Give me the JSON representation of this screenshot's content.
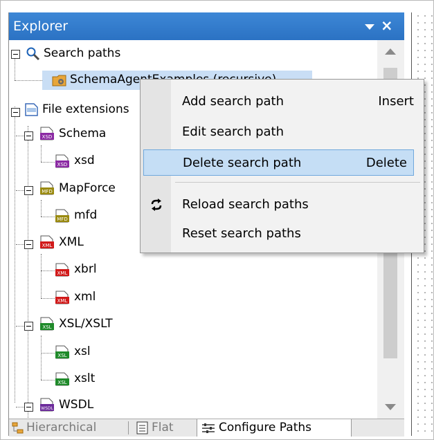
{
  "panel": {
    "title": "Explorer"
  },
  "tree": {
    "search_paths": "Search paths",
    "schema_agent": "SchemaAgentExamples (recursive)",
    "file_extensions": "File extensions",
    "schema": "Schema",
    "xsd": "xsd",
    "mapforce": "MapForce",
    "mfd": "mfd",
    "xml_group": "XML",
    "xbrl": "xbrl",
    "xml": "xml",
    "xsl_group": "XSL/XSLT",
    "xsl": "xsl",
    "xslt": "xslt",
    "wsdl": "WSDL"
  },
  "tabs": {
    "hierarchical": "Hierarchical",
    "flat": "Flat",
    "configure": "Configure Paths"
  },
  "menu": {
    "add": {
      "label": "Add search path",
      "shortcut": "Insert"
    },
    "edit": {
      "label": "Edit search path"
    },
    "delete": {
      "label": "Delete search path",
      "shortcut": "Delete"
    },
    "reload": {
      "label": "Reload search paths"
    },
    "reset": {
      "label": "Reset search paths"
    }
  },
  "icons": {
    "xsd_badge": "XSD",
    "mfd_badge": "MFD",
    "xml_badge": "XML",
    "xsl_badge": "XSL",
    "wsdl_badge": "WSDL"
  },
  "colors": {
    "titlebar": "#2b72c3",
    "xsd": "#8b2aa3",
    "mfd": "#9a8a10",
    "xml": "#d11a1a",
    "xsl": "#1f8a2a",
    "wsdl": "#6b2a9a",
    "folder": "#e8a63a",
    "menu_highlight": "#c5def5"
  }
}
